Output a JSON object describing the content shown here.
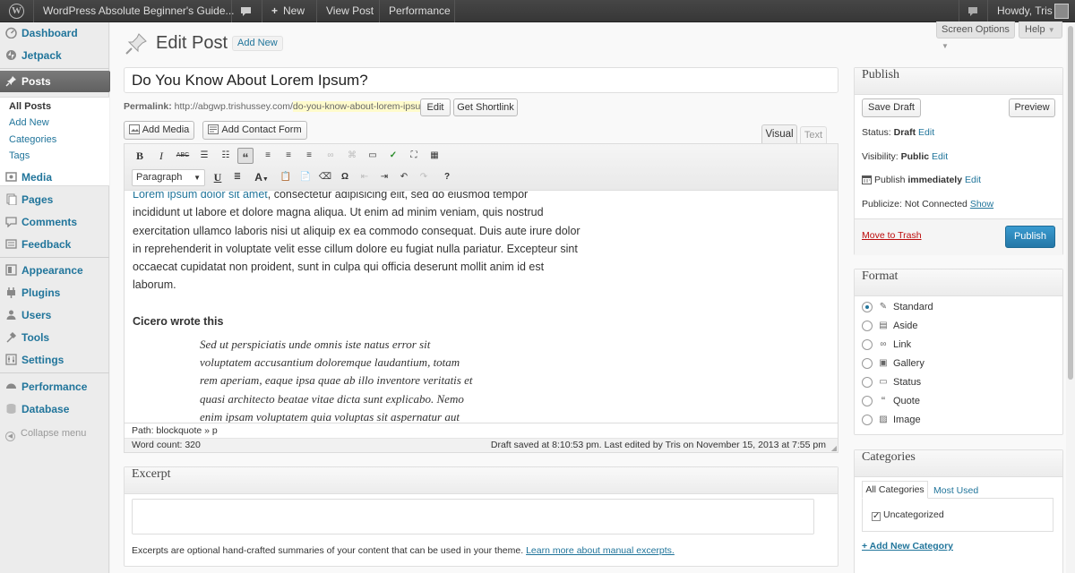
{
  "admin_bar": {
    "site_name": "WordPress Absolute Beginner's Guide...",
    "new_label": "New",
    "view_post": "View Post",
    "performance": "Performance",
    "greeting": "Howdy, Tris"
  },
  "sidebar": {
    "items": [
      {
        "label": "Dashboard",
        "icon": "dashboard-icon"
      },
      {
        "label": "Jetpack",
        "icon": "jetpack-icon"
      },
      {
        "label": "Posts",
        "icon": "pin-icon"
      },
      {
        "label": "Media",
        "icon": "media-icon"
      },
      {
        "label": "Pages",
        "icon": "pages-icon"
      },
      {
        "label": "Comments",
        "icon": "comments-icon"
      },
      {
        "label": "Feedback",
        "icon": "feedback-icon"
      },
      {
        "label": "Appearance",
        "icon": "appearance-icon"
      },
      {
        "label": "Plugins",
        "icon": "plugins-icon"
      },
      {
        "label": "Users",
        "icon": "users-icon"
      },
      {
        "label": "Tools",
        "icon": "tools-icon"
      },
      {
        "label": "Settings",
        "icon": "settings-icon"
      },
      {
        "label": "Performance",
        "icon": "performance-icon"
      },
      {
        "label": "Database",
        "icon": "database-icon"
      }
    ],
    "posts_submenu": [
      "All Posts",
      "Add New",
      "Categories",
      "Tags"
    ],
    "collapse": "Collapse menu"
  },
  "header": {
    "title": "Edit Post",
    "add_new": "Add New",
    "screen_options": "Screen Options",
    "help": "Help"
  },
  "post": {
    "title": "Do You Know About Lorem Ipsum?",
    "permalink_label": "Permalink:",
    "permalink_base": "http://abgwp.trishussey.com/",
    "permalink_slug": "do-you-know-about-lorem-ipsum/",
    "edit_btn": "Edit",
    "shortlink_btn": "Get Shortlink",
    "add_media": "Add Media",
    "add_contact_form": "Add Contact Form",
    "tab_visual": "Visual",
    "tab_text": "Text",
    "format_select": "Paragraph",
    "content": {
      "line0_link": "Lorem ipsum dolor sit amet",
      "line0_rest": ", consectetur adipisicing elit, sed do eiusmod tempor",
      "line1": "incididunt ut labore et dolore magna aliqua. Ut enim ad minim veniam, quis nostrud",
      "line2": "exercitation ullamco laboris nisi ut aliquip ex ea commodo consequat. Duis aute irure dolor",
      "line3": "in reprehenderit in voluptate velit esse cillum dolore eu fugiat nulla pariatur. Excepteur sint",
      "line4": "occaecat cupidatat non proident, sunt in culpa qui officia deserunt mollit anim id est",
      "line5": "laborum.",
      "heading": "Cicero wrote this",
      "quote1": "Sed ut perspiciatis unde omnis iste natus error sit",
      "quote2": "voluptatem accusantium doloremque laudantium, totam",
      "quote3": "rem aperiam, eaque ipsa quae ab illo inventore veritatis et",
      "quote4": "quasi architecto beatae vitae dicta sunt explicabo. Nemo",
      "quote5": "enim ipsam voluptatem quia voluptas sit aspernatur aut"
    },
    "path": "Path: blockquote » p",
    "word_count": "Word count: 320",
    "draft_status": "Draft saved at 8:10:53 pm. Last edited by Tris on November 15, 2013 at 7:55 pm"
  },
  "excerpt": {
    "title": "Excerpt",
    "help_text": "Excerpts are optional hand-crafted summaries of your content that can be used in your theme.",
    "help_link": "Learn more about manual excerpts."
  },
  "publish": {
    "title": "Publish",
    "save_draft": "Save Draft",
    "preview": "Preview",
    "status_label": "Status:",
    "status_value": "Draft",
    "visibility_label": "Visibility:",
    "visibility_value": "Public",
    "publish_label": "Publish",
    "publish_value": "immediately",
    "publicize_label": "Publicize: Not Connected",
    "show": "Show",
    "edit": "Edit",
    "trash": "Move to Trash",
    "publish_btn": "Publish"
  },
  "format": {
    "title": "Format",
    "options": [
      "Standard",
      "Aside",
      "Link",
      "Gallery",
      "Status",
      "Quote",
      "Image"
    ],
    "selected": "Standard"
  },
  "categories": {
    "title": "Categories",
    "tab_all": "All Categories",
    "tab_most": "Most Used",
    "items": [
      "Uncategorized"
    ],
    "add_new": "+ Add New Category"
  },
  "colors": {
    "link": "#21759b",
    "publish_button": "#2e8bba",
    "trash": "#bc0b0b"
  }
}
